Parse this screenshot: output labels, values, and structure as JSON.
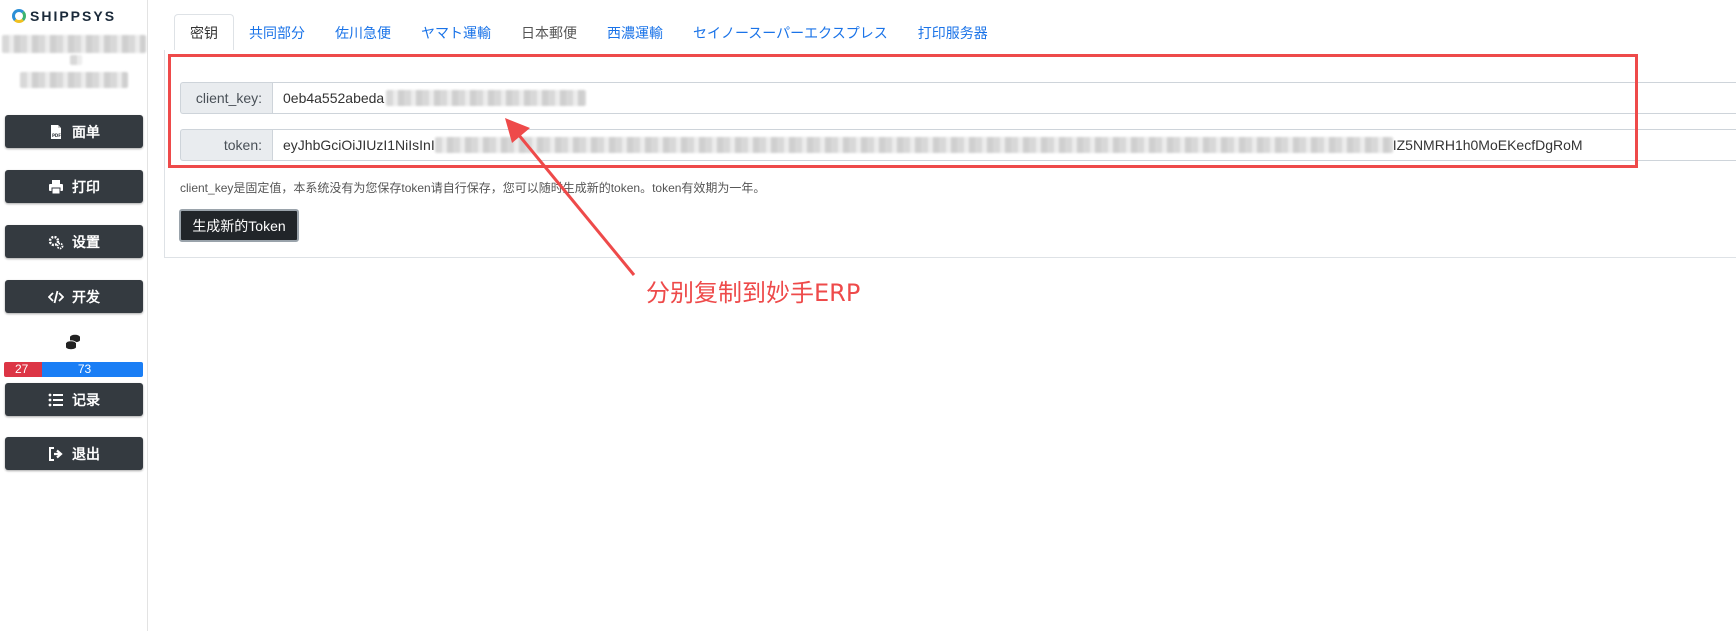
{
  "brand": {
    "name": "SHIPPSYS"
  },
  "sidebar": {
    "items": [
      {
        "label": "面单",
        "icon": "pdf-file-icon"
      },
      {
        "label": "打印",
        "icon": "printer-icon"
      },
      {
        "label": "设置",
        "icon": "gears-icon"
      },
      {
        "label": "开发",
        "icon": "code-icon"
      },
      {
        "label": "记录",
        "icon": "list-icon"
      },
      {
        "label": "退出",
        "icon": "sign-out-icon"
      }
    ],
    "quota": {
      "used": "27",
      "remaining": "73",
      "icon": "database-icon"
    }
  },
  "tabs": [
    {
      "label": "密钥",
      "active": true
    },
    {
      "label": "共同部分"
    },
    {
      "label": "佐川急便"
    },
    {
      "label": "ヤマト運輸"
    },
    {
      "label": "日本郵便"
    },
    {
      "label": "西濃運輸"
    },
    {
      "label": "セイノースーパーエクスプレス"
    },
    {
      "label": "打印服务器"
    }
  ],
  "form": {
    "client_key": {
      "label": "client_key:",
      "value_visible": "0eb4a552abeda"
    },
    "token": {
      "label": "token:",
      "value_start": "eyJhbGciOiJIUzI1NiIsInI",
      "value_end": "IZ5NMRH1h0MoEKecfDgRoM"
    },
    "help_text": "client_key是固定值，本系统没有为您保存token请自行保存，您可以随时生成新的token。token有效期为一年。",
    "generate_button": "生成新的Token"
  },
  "annotation": {
    "text": "分别复制到妙手ERP",
    "color": "#ee4a4a"
  }
}
